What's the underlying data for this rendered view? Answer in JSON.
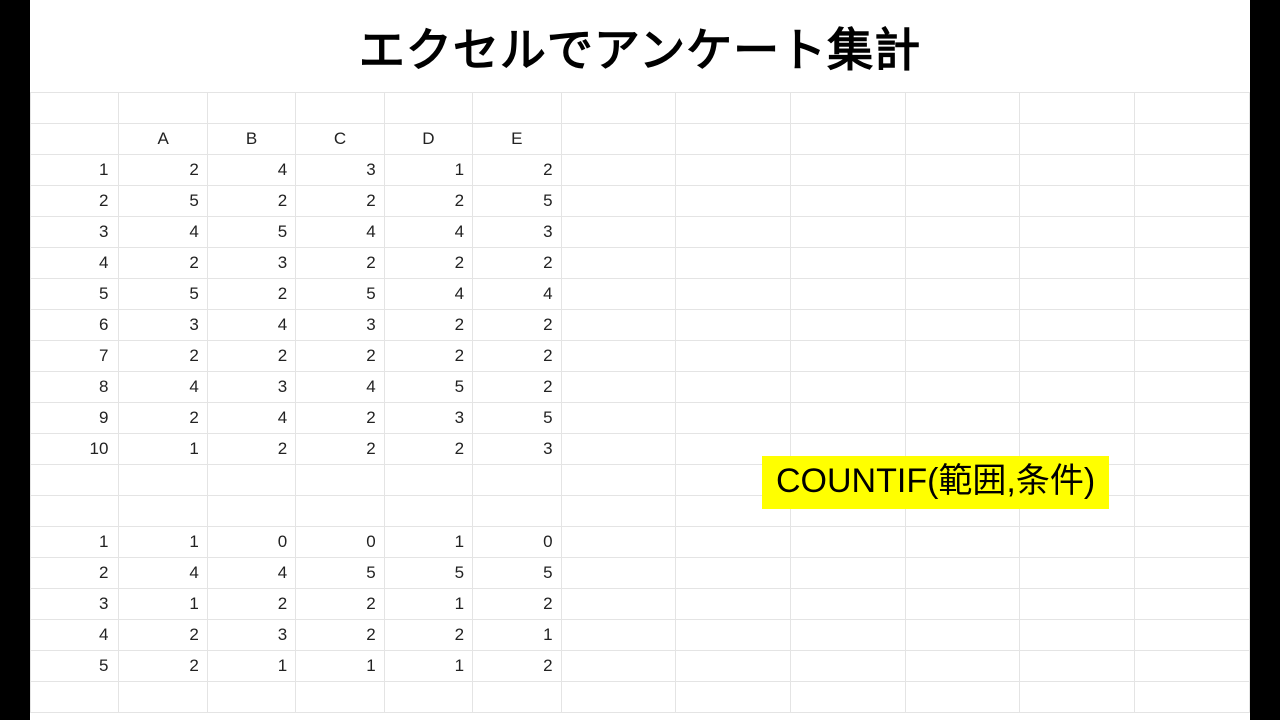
{
  "title": "エクセルでアンケート集計",
  "column_headers": [
    "A",
    "B",
    "C",
    "D",
    "E"
  ],
  "data_rows": [
    {
      "idx": "1",
      "v": [
        "2",
        "4",
        "3",
        "1",
        "2"
      ]
    },
    {
      "idx": "2",
      "v": [
        "5",
        "2",
        "2",
        "2",
        "5"
      ]
    },
    {
      "idx": "3",
      "v": [
        "4",
        "5",
        "4",
        "4",
        "3"
      ]
    },
    {
      "idx": "4",
      "v": [
        "2",
        "3",
        "2",
        "2",
        "2"
      ]
    },
    {
      "idx": "5",
      "v": [
        "5",
        "2",
        "5",
        "4",
        "4"
      ]
    },
    {
      "idx": "6",
      "v": [
        "3",
        "4",
        "3",
        "2",
        "2"
      ]
    },
    {
      "idx": "7",
      "v": [
        "2",
        "2",
        "2",
        "2",
        "2"
      ]
    },
    {
      "idx": "8",
      "v": [
        "4",
        "3",
        "4",
        "5",
        "2"
      ]
    },
    {
      "idx": "9",
      "v": [
        "2",
        "4",
        "2",
        "3",
        "5"
      ]
    },
    {
      "idx": "10",
      "v": [
        "1",
        "2",
        "2",
        "2",
        "3"
      ]
    }
  ],
  "summary_rows": [
    {
      "idx": "1",
      "v": [
        "1",
        "0",
        "0",
        "1",
        "0"
      ]
    },
    {
      "idx": "2",
      "v": [
        "4",
        "4",
        "5",
        "5",
        "5"
      ]
    },
    {
      "idx": "3",
      "v": [
        "1",
        "2",
        "2",
        "1",
        "2"
      ]
    },
    {
      "idx": "4",
      "v": [
        "2",
        "3",
        "2",
        "2",
        "1"
      ]
    },
    {
      "idx": "5",
      "v": [
        "2",
        "1",
        "1",
        "1",
        "2"
      ]
    }
  ],
  "callout": "COUNTIF(範囲,条件)",
  "chart_data": {
    "type": "table",
    "title": "エクセルでアンケート集計",
    "raw_responses": {
      "columns": [
        "A",
        "B",
        "C",
        "D",
        "E"
      ],
      "rows": [
        [
          2,
          4,
          3,
          1,
          2
        ],
        [
          5,
          2,
          2,
          2,
          5
        ],
        [
          4,
          5,
          4,
          4,
          3
        ],
        [
          2,
          3,
          2,
          2,
          2
        ],
        [
          5,
          2,
          5,
          4,
          4
        ],
        [
          3,
          4,
          3,
          2,
          2
        ],
        [
          2,
          2,
          2,
          2,
          2
        ],
        [
          4,
          3,
          4,
          5,
          2
        ],
        [
          2,
          4,
          2,
          3,
          5
        ],
        [
          1,
          2,
          2,
          2,
          3
        ]
      ]
    },
    "countif_summary": {
      "columns": [
        "A",
        "B",
        "C",
        "D",
        "E"
      ],
      "value_labels": [
        1,
        2,
        3,
        4,
        5
      ],
      "counts": [
        [
          1,
          0,
          0,
          1,
          0
        ],
        [
          4,
          4,
          5,
          5,
          5
        ],
        [
          1,
          2,
          2,
          1,
          2
        ],
        [
          2,
          3,
          2,
          2,
          1
        ],
        [
          2,
          1,
          1,
          1,
          2
        ]
      ]
    }
  }
}
